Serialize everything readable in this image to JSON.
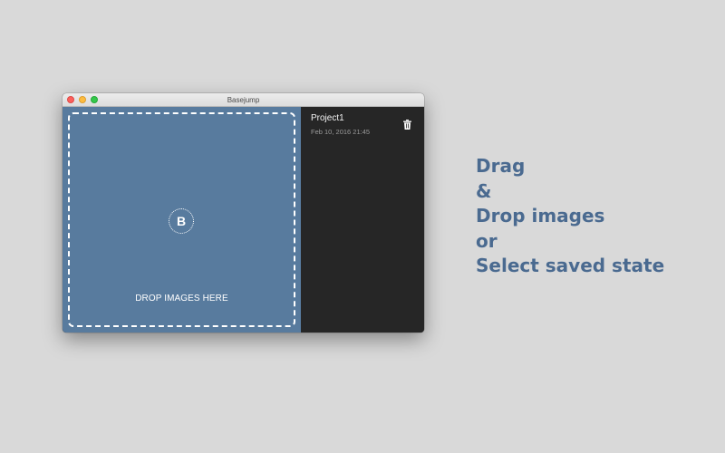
{
  "window": {
    "title": "Basejump"
  },
  "dropzone": {
    "logo_letter": "B",
    "label": "DROP IMAGES HERE"
  },
  "saved_states": [
    {
      "name": "Project1",
      "date": "Feb 10, 2016 21:45"
    }
  ],
  "promo": {
    "lines": [
      "Drag",
      "&",
      "Drop images",
      "or",
      "Select saved state"
    ]
  },
  "colors": {
    "background": "#d9d9d9",
    "dropzone": "#587b9e",
    "sidebar": "#262626",
    "promo_text": "#4a6a90"
  },
  "icons": {
    "window_controls": [
      "close-icon",
      "minimize-icon",
      "zoom-icon"
    ],
    "delete": "trash-icon",
    "logo": "basejump-logo-icon"
  }
}
